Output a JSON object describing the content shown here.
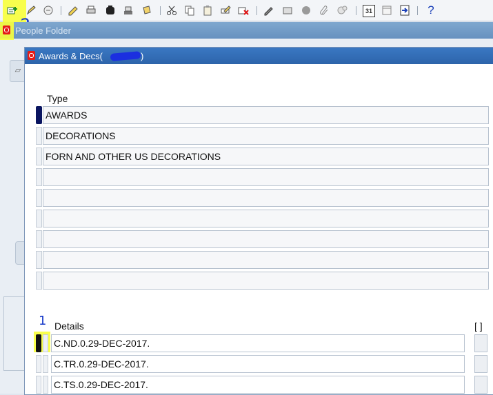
{
  "toolbar": {
    "icons": [
      "new-record-icon",
      "edit-icon",
      "translate-icon",
      "save-icon",
      "print-icon",
      "find-icon",
      "attachments-icon",
      "cut-icon",
      "copy-icon",
      "paste-icon",
      "clear-record-icon",
      "delete-record-icon",
      "edit-field-icon",
      "zoom-icon",
      "circle-icon",
      "paperclip-icon",
      "folder-tools-icon",
      "calendar-icon",
      "window-icon",
      "exit-icon",
      "help-icon"
    ],
    "help_label": "?",
    "calendar_label": "31"
  },
  "annotations": {
    "two": "2",
    "one": "1"
  },
  "background_window": {
    "title": "People Folder"
  },
  "awards_window": {
    "title": "Awards & Decs(",
    "title_suffix": ")",
    "type_section": {
      "header": "Type",
      "rows": [
        "AWARDS",
        "DECORATIONS",
        "FORN AND OTHER US DECORATIONS",
        "",
        "",
        "",
        "",
        "",
        ""
      ]
    },
    "details_section": {
      "header": "Details",
      "bracket_header": "[ ]",
      "rows": [
        "C.ND.0.29-DEC-2017.",
        "C.TR.0.29-DEC-2017.",
        "C.TS.0.29-DEC-2017."
      ]
    }
  },
  "colors": {
    "title_bar": "#2d64aa",
    "selected_indicator": "#0a1560",
    "highlight": "#f8ff3a",
    "annotation_ink": "#1538c8"
  }
}
